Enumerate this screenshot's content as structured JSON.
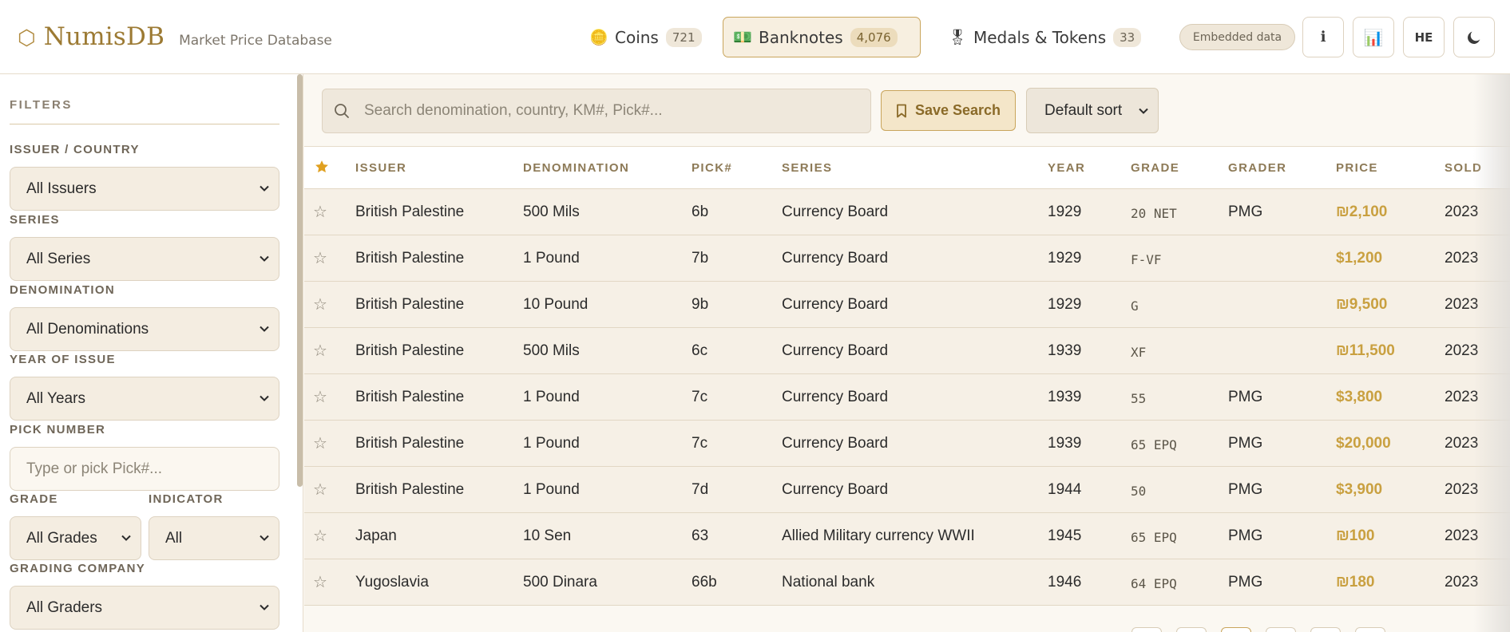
{
  "brand": {
    "icon": "hexagon-icon",
    "icon_glyph": "⬡",
    "name": "NumisDB",
    "subtitle": "Market Price Database"
  },
  "tabs": [
    {
      "label": "Coins",
      "count": "721",
      "icon": "coin-icon",
      "glyph": "🪙",
      "active": false
    },
    {
      "label": "Banknotes",
      "count": "4,076",
      "icon": "banknote-icon",
      "glyph": "💵",
      "active": true
    },
    {
      "label": "Medals & Tokens",
      "count": "33",
      "icon": "medal-icon",
      "glyph": "🎖",
      "active": false
    }
  ],
  "header_right": {
    "embedded_label": "Embedded data",
    "info_glyph": "ℹ",
    "stats_glyph": "📊",
    "lang_label": "HE",
    "theme_icon": "moon-icon"
  },
  "filters": {
    "title": "FILTERS",
    "issuer_label": "ISSUER / COUNTRY",
    "issuer_value": "All Issuers",
    "series_label": "SERIES",
    "series_value": "All Series",
    "denomination_label": "DENOMINATION",
    "denomination_value": "All Denominations",
    "year_label": "YEAR OF ISSUE",
    "year_value": "All Years",
    "pick_label": "PICK NUMBER",
    "pick_placeholder": "Type or pick Pick#...",
    "grade_label": "GRADE",
    "grade_value": "All Grades",
    "indicator_label": "INDICATOR",
    "indicator_value": "All",
    "company_label": "GRADING COMPANY",
    "company_value": "All Graders"
  },
  "search": {
    "placeholder": "Search denomination, country, KM#, Pick#...",
    "save_label": "Save Search",
    "sort_value": "Default sort"
  },
  "table": {
    "columns": [
      "ISSUER",
      "DENOMINATION",
      "PICK#",
      "SERIES",
      "YEAR",
      "GRADE",
      "GRADER",
      "PRICE",
      "SOLD"
    ],
    "rows": [
      {
        "issuer": "British Palestine",
        "denomination": "500 Mils",
        "pick": "6b",
        "series": "Currency Board",
        "year": "1929",
        "grade": "20 NET",
        "grader": "PMG",
        "price": "₪2,100",
        "sold": "2023"
      },
      {
        "issuer": "British Palestine",
        "denomination": "1 Pound",
        "pick": "7b",
        "series": "Currency Board",
        "year": "1929",
        "grade": "F-VF",
        "grader": "",
        "price": "$1,200",
        "sold": "2023"
      },
      {
        "issuer": "British Palestine",
        "denomination": "10 Pound",
        "pick": "9b",
        "series": "Currency Board",
        "year": "1929",
        "grade": "G",
        "grader": "",
        "price": "₪9,500",
        "sold": "2023"
      },
      {
        "issuer": "British Palestine",
        "denomination": "500 Mils",
        "pick": "6c",
        "series": "Currency Board",
        "year": "1939",
        "grade": "XF",
        "grader": "",
        "price": "₪11,500",
        "sold": "2023"
      },
      {
        "issuer": "British Palestine",
        "denomination": "1 Pound",
        "pick": "7c",
        "series": "Currency Board",
        "year": "1939",
        "grade": "55",
        "grader": "PMG",
        "price": "$3,800",
        "sold": "2023"
      },
      {
        "issuer": "British Palestine",
        "denomination": "1 Pound",
        "pick": "7c",
        "series": "Currency Board",
        "year": "1939",
        "grade": "65 EPQ",
        "grader": "PMG",
        "price": "$20,000",
        "sold": "2023"
      },
      {
        "issuer": "British Palestine",
        "denomination": "1 Pound",
        "pick": "7d",
        "series": "Currency Board",
        "year": "1944",
        "grade": "50",
        "grader": "PMG",
        "price": "$3,900",
        "sold": "2023"
      },
      {
        "issuer": "Japan",
        "denomination": "10 Sen",
        "pick": "63",
        "series": "Allied Military currency WWII",
        "year": "1945",
        "grade": "65 EPQ",
        "grader": "PMG",
        "price": "₪100",
        "sold": "2023"
      },
      {
        "issuer": "Yugoslavia",
        "denomination": "500 Dinara",
        "pick": "66b",
        "series": "National bank",
        "year": "1946",
        "grade": "64 EPQ",
        "grader": "PMG",
        "price": "₪180",
        "sold": "2023"
      }
    ]
  },
  "colors": {
    "accent": "#c9a040",
    "brand": "#9c7a33",
    "panel": "#f6f0e6"
  }
}
